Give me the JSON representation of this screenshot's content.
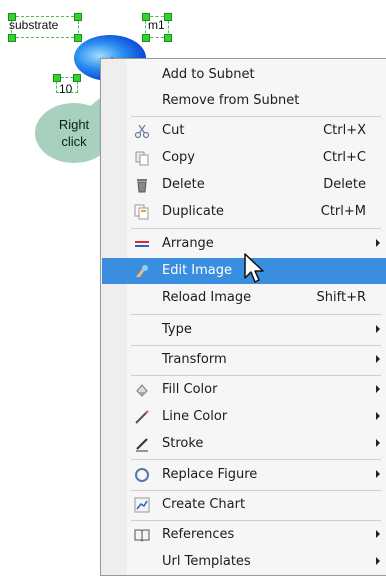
{
  "diagram": {
    "node_substrate": "substrate",
    "node_m1": "m1",
    "node_count": "10",
    "tooltip": [
      "Right",
      "click"
    ]
  },
  "menu": {
    "items": [
      {
        "label": "Add to Subnet",
        "icon": null,
        "shortcut": "",
        "submenu": false
      },
      {
        "label": "Remove from Subnet",
        "icon": null,
        "shortcut": "",
        "submenu": false
      },
      {
        "label": "Cut",
        "icon": "scissors-icon",
        "shortcut": "Ctrl+X",
        "submenu": false
      },
      {
        "label": "Copy",
        "icon": "copy-icon",
        "shortcut": "Ctrl+C",
        "submenu": false
      },
      {
        "label": "Delete",
        "icon": "trash-icon",
        "shortcut": "Delete",
        "submenu": false
      },
      {
        "label": "Duplicate",
        "icon": "duplicate-icon",
        "shortcut": "Ctrl+M",
        "submenu": false
      },
      {
        "label": "Arrange",
        "icon": "arrange-icon",
        "shortcut": "",
        "submenu": true
      },
      {
        "label": "Edit Image",
        "icon": "image-edit-icon",
        "shortcut": "",
        "submenu": false,
        "highlighted": true
      },
      {
        "label": "Reload Image",
        "icon": null,
        "shortcut": "Shift+R",
        "submenu": false
      },
      {
        "label": "Type",
        "icon": null,
        "shortcut": "",
        "submenu": true
      },
      {
        "label": "Transform",
        "icon": null,
        "shortcut": "",
        "submenu": true
      },
      {
        "label": "Fill Color",
        "icon": "fill-color-icon",
        "shortcut": "",
        "submenu": true
      },
      {
        "label": "Line Color",
        "icon": "line-color-icon",
        "shortcut": "",
        "submenu": true
      },
      {
        "label": "Stroke",
        "icon": "stroke-icon",
        "shortcut": "",
        "submenu": true
      },
      {
        "label": "Replace Figure",
        "icon": "replace-figure-icon",
        "shortcut": "",
        "submenu": true
      },
      {
        "label": "Create Chart",
        "icon": "chart-icon",
        "shortcut": "",
        "submenu": false
      },
      {
        "label": "References",
        "icon": "book-icon",
        "shortcut": "",
        "submenu": true
      },
      {
        "label": "Url Templates",
        "icon": null,
        "shortcut": "",
        "submenu": true
      }
    ]
  },
  "colors": {
    "highlight": "#3a8ee0",
    "tooltip_bg": "#a8d0be",
    "selection_handle": "#2fd42f"
  }
}
